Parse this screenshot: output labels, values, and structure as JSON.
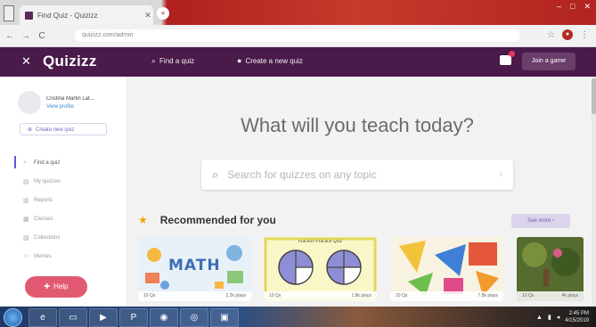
{
  "browser": {
    "tab_title": "Find Quiz - Quizizz",
    "tab_close": "✕",
    "new_tab": "+",
    "back": "←",
    "forward": "→",
    "reload": "C",
    "url": "quizizz.com/admin",
    "window_controls": [
      "–",
      "□",
      "✕"
    ]
  },
  "topbar": {
    "close": "✕",
    "logo": "Quizizz",
    "find_quiz": "Find a quiz",
    "create_quiz": "Create a new quiz",
    "join_game": "Join a game"
  },
  "sidebar": {
    "profile_name": "Cristina Martin Lat...",
    "profile_link": "View profile",
    "create_button": "Create new quiz",
    "items": [
      {
        "icon": "search-icon",
        "glyph": "⌕",
        "label": "Find a quiz",
        "active": true
      },
      {
        "icon": "quizzes-icon",
        "glyph": "▤",
        "label": "My quizzes",
        "active": false
      },
      {
        "icon": "reports-icon",
        "glyph": "▥",
        "label": "Reports",
        "active": false
      },
      {
        "icon": "classes-icon",
        "glyph": "▦",
        "label": "Classes",
        "active": false
      },
      {
        "icon": "collections-icon",
        "glyph": "▧",
        "label": "Collections",
        "active": false
      },
      {
        "icon": "memes-icon",
        "glyph": "☺",
        "label": "Memes",
        "active": false
      }
    ],
    "help": "Help"
  },
  "main": {
    "headline": "What will you teach today?",
    "search_placeholder": "Search for quizzes on any topic",
    "search_arrow": "›",
    "recommended": "Recommended for you",
    "see_more": "See more ›",
    "cards": [
      {
        "title": "MATH",
        "questions": "10 Qs",
        "plays": "1.2k plays"
      },
      {
        "title": "Fraction Practice Quiz",
        "questions": "10 Qs",
        "plays": "1.8k plays"
      },
      {
        "title": "",
        "questions": "10 Qs",
        "plays": "7.5k plays"
      },
      {
        "title": "",
        "questions": "10 Qs",
        "plays": "4k plays"
      }
    ]
  },
  "taskbar": {
    "time": "2:45 PM",
    "date": "4/15/2019"
  },
  "colors": {
    "brand_purple": "#4a1a4a",
    "help_pink": "#e25a72",
    "accent_violet": "#5b5bd6",
    "star_gold": "#f0a400"
  }
}
